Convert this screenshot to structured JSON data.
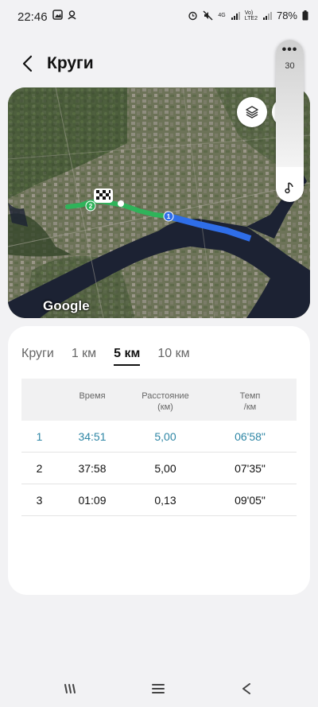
{
  "status": {
    "time": "22:46",
    "battery": "78%",
    "net_4g": "4G",
    "volte_1": "Vo)",
    "volte_2": "LTE2"
  },
  "header": {
    "title": "Круги"
  },
  "map": {
    "attribution": "Google",
    "lap_markers": [
      "1",
      "2"
    ]
  },
  "side_panel": {
    "value": "30"
  },
  "tabs": [
    "Круги",
    "1 км",
    "5 км",
    "10 км"
  ],
  "active_tab": "5 км",
  "table": {
    "headers": [
      "",
      "Время",
      "Расстояние\n(км)",
      "Темп\n/км"
    ],
    "rows": [
      {
        "num": "1",
        "time": "34:51",
        "distance": "5,00",
        "pace": "06'58\""
      },
      {
        "num": "2",
        "time": "37:58",
        "distance": "5,00",
        "pace": "07'35\""
      },
      {
        "num": "3",
        "time": "01:09",
        "distance": "0,13",
        "pace": "09'05\""
      }
    ]
  },
  "colors": {
    "accent": "#2e86a5",
    "route_green": "#2fb35a",
    "route_blue": "#2f6ee8"
  }
}
